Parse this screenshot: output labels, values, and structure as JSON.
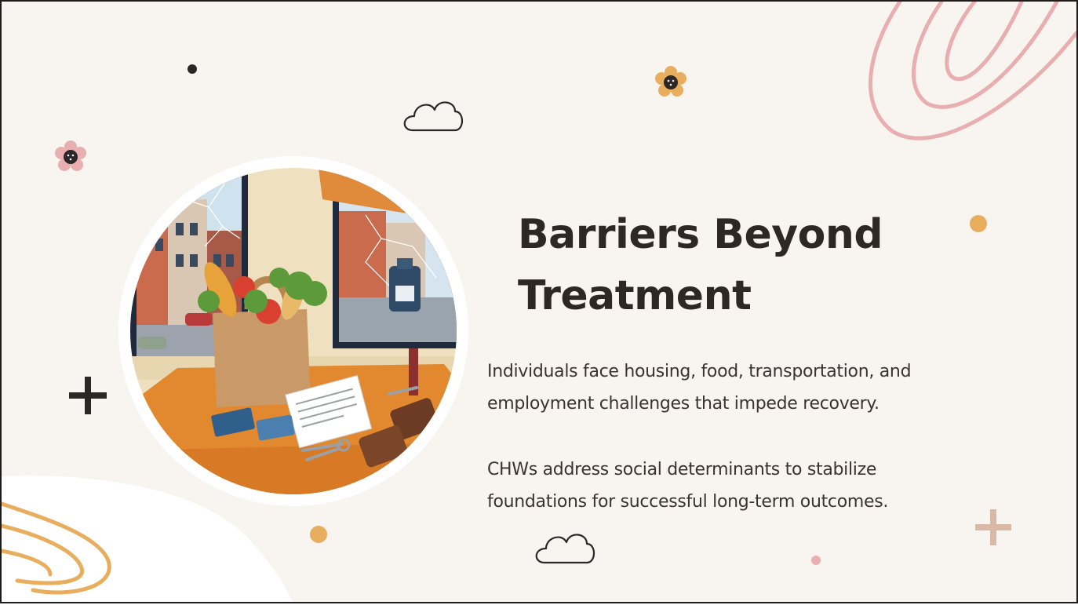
{
  "slide": {
    "title_line1": "Barriers Beyond",
    "title_line2": "Treatment",
    "paragraph1_line1": "Individuals face housing, food, transportation, and",
    "paragraph1_line2": "employment challenges that impede recovery.",
    "paragraph2_line1": "CHWs address social determinants to stabilize",
    "paragraph2_line2": "foundations for successful long-term outcomes."
  },
  "colors": {
    "background": "#f8f5f1",
    "title_text": "#2e2825",
    "body_text": "#3a3431",
    "accent_orange": "#e8ae5e",
    "accent_pink": "#e8aeb0",
    "accent_tan": "#d9b9a5",
    "dark": "#2b2726"
  },
  "icons": [
    "flower-icon",
    "cloud-icon",
    "plus-icon",
    "dot-icon",
    "squiggle-icon"
  ]
}
